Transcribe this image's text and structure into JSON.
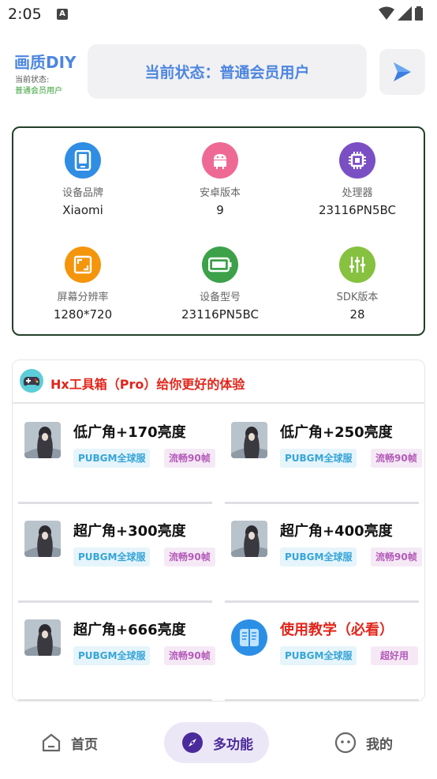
{
  "statusbar": {
    "time": "2:05",
    "notif_letter": "A"
  },
  "header": {
    "brand_title": "画质DIY",
    "status_label": "当前状态:",
    "status_value": "普通会员用户",
    "status_pill_text": "当前状态：普通会员用户"
  },
  "device_info": [
    {
      "icon": "tablet-icon",
      "color": "#2f8de4",
      "label": "设备品牌",
      "value": "Xiaomi"
    },
    {
      "icon": "android-icon",
      "color": "#ee6a95",
      "label": "安卓版本",
      "value": "9"
    },
    {
      "icon": "cpu-icon",
      "color": "#7b4fc4",
      "label": "处理器",
      "value": "23116PN5BC"
    },
    {
      "icon": "resolution-icon",
      "color": "#f5950b",
      "label": "屏幕分辨率",
      "value": "1280*720"
    },
    {
      "icon": "battery-icon",
      "color": "#3ca149",
      "label": "设备型号",
      "value": "23116PN5BC"
    },
    {
      "icon": "sliders-icon",
      "color": "#86c13f",
      "label": "SDK版本",
      "value": "28"
    }
  ],
  "tools": {
    "title": "Hx工具箱（Pro）给你更好的体验",
    "items": [
      {
        "name": "低广角+170亮度",
        "tag1": "PUBGM全球服",
        "tag2": "流畅90帧",
        "thumb": "avatar",
        "name_color": "#111"
      },
      {
        "name": "低广角+250亮度",
        "tag1": "PUBGM全球服",
        "tag2": "流畅90帧",
        "thumb": "avatar",
        "name_color": "#111"
      },
      {
        "name": "超广角+300亮度",
        "tag1": "PUBGM全球服",
        "tag2": "流畅90帧",
        "thumb": "avatar",
        "name_color": "#111"
      },
      {
        "name": "超广角+400亮度",
        "tag1": "PUBGM全球服",
        "tag2": "流畅90帧",
        "thumb": "avatar",
        "name_color": "#111"
      },
      {
        "name": "超广角+666亮度",
        "tag1": "PUBGM全球服",
        "tag2": "流畅90帧",
        "thumb": "avatar",
        "name_color": "#111"
      },
      {
        "name": "使用教学（必看）",
        "tag1": "PUBGM全球服",
        "tag2": "超好用",
        "thumb": "book-icon",
        "name_color": "#e1251b"
      }
    ]
  },
  "bottom_nav": {
    "home": "首页",
    "multi": "多功能",
    "mine": "我的"
  }
}
